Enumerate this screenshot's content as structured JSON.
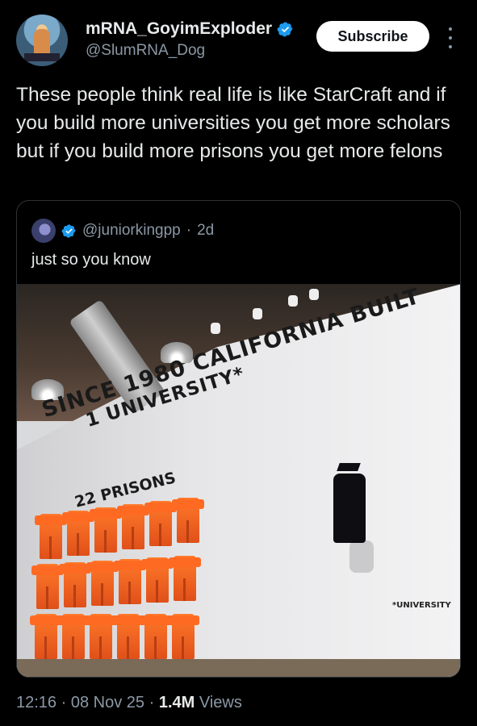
{
  "author": {
    "display_name": "mRNA_GoyimExploder",
    "handle": "@SlumRNA_Dog",
    "verified_color": "#1d9bf0"
  },
  "actions": {
    "subscribe_label": "Subscribe",
    "more_icon": "more-vertical-icon"
  },
  "tweet": {
    "text": "These people think real life is like StarCraft and if you build more universities you get more scholars but if you build more prisons you get more felons"
  },
  "quote": {
    "handle": "@juniorkingpp",
    "separator": "·",
    "age": "2d",
    "text": "just so you know",
    "photo": {
      "headline_line1": "SINCE 1980 CALIFORNIA BUILT",
      "headline_line2": "1 UNIVERSITY*",
      "prisons_label": "22 PRISONS",
      "footnote": "*UNIVERSITY"
    }
  },
  "meta": {
    "time": "12:16",
    "sep1": "·",
    "date": "08 Nov 25",
    "sep2": "·",
    "views_count": "1.4M",
    "views_label": "Views"
  }
}
